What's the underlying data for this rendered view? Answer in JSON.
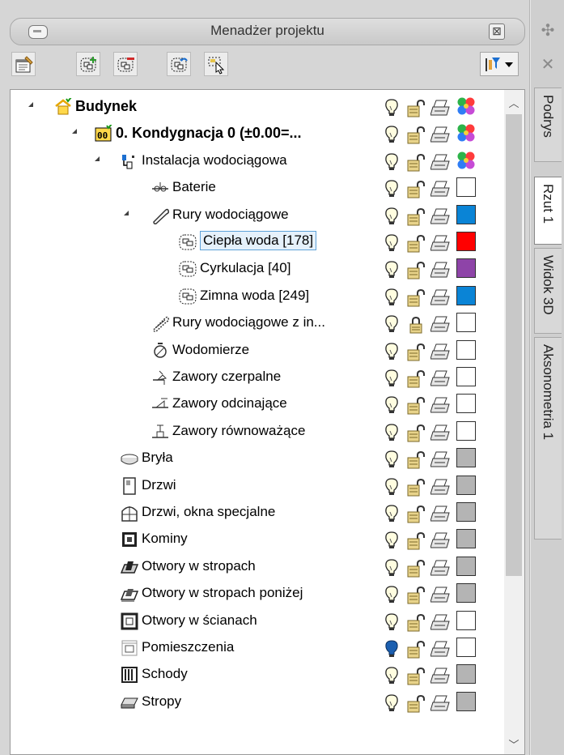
{
  "panel": {
    "title": "Menadżer projektu",
    "close_symbol": "⊠"
  },
  "toolbar": {
    "buttons": [
      "properties-icon",
      "add-layer-icon",
      "remove-layer-icon",
      "move-layer-icon",
      "select-tool-icon"
    ],
    "filter": "filter-dropdown"
  },
  "tree": {
    "rows": [
      {
        "label": "Budynek",
        "level": 0,
        "toggle": "open",
        "icon": "building-icon",
        "bold": true,
        "bulb": "on",
        "lock": "unlocked",
        "color": "multi"
      },
      {
        "label": "0. Kondygnacja 0 (±0.00=...",
        "level": 1,
        "toggle": "open",
        "icon": "storey-icon",
        "bold": true,
        "bulb": "on",
        "lock": "unlocked",
        "color": "multi"
      },
      {
        "label": "Instalacja wodociągowa",
        "level": 2,
        "toggle": "open",
        "icon": "installation-icon",
        "bulb": "on",
        "lock": "unlocked",
        "color": "multi"
      },
      {
        "label": "Baterie",
        "level": 3,
        "toggle": "none",
        "icon": "faucet-icon",
        "bulb": "on",
        "lock": "unlocked",
        "color": "#ffffff"
      },
      {
        "label": "Rury wodociągowe",
        "level": 3,
        "toggle": "open",
        "icon": "pipe-icon",
        "bulb": "on",
        "lock": "unlocked",
        "color": "#0a84d6"
      },
      {
        "label": "Ciepła woda [178]",
        "level": 4,
        "toggle": "none",
        "icon": "layer-icon",
        "selected": true,
        "bulb": "on",
        "lock": "unlocked",
        "color": "#ff0000"
      },
      {
        "label": "Cyrkulacja [40]",
        "level": 4,
        "toggle": "none",
        "icon": "layer-icon",
        "bulb": "on",
        "lock": "unlocked",
        "color": "#8e44a8"
      },
      {
        "label": "Zimna woda [249]",
        "level": 4,
        "toggle": "none",
        "icon": "layer-icon",
        "bulb": "on",
        "lock": "unlocked",
        "color": "#0a84d6"
      },
      {
        "label": "Rury wodociągowe z in...",
        "level": 3,
        "toggle": "none",
        "icon": "insulated-pipe-icon",
        "bulb": "on",
        "lock": "locked",
        "color": "#ffffff"
      },
      {
        "label": "Wodomierze",
        "level": 3,
        "toggle": "none",
        "icon": "water-meter-icon",
        "bulb": "on",
        "lock": "unlocked",
        "color": "#ffffff"
      },
      {
        "label": "Zawory czerpalne",
        "level": 3,
        "toggle": "none",
        "icon": "tap-valve-icon",
        "bulb": "on",
        "lock": "unlocked",
        "color": "#ffffff"
      },
      {
        "label": "Zawory odcinające",
        "level": 3,
        "toggle": "none",
        "icon": "shutoff-valve-icon",
        "bulb": "on",
        "lock": "unlocked",
        "color": "#ffffff"
      },
      {
        "label": "Zawory równoważące",
        "level": 3,
        "toggle": "none",
        "icon": "balancing-valve-icon",
        "bulb": "on",
        "lock": "unlocked",
        "color": "#ffffff"
      },
      {
        "label": "Bryła",
        "level": 2,
        "toggle": "none",
        "icon": "solid-icon",
        "bulb": "on",
        "lock": "unlocked",
        "color": "#b4b4b4"
      },
      {
        "label": "Drzwi",
        "level": 2,
        "toggle": "none",
        "icon": "door-icon",
        "bulb": "on",
        "lock": "unlocked",
        "color": "#b4b4b4"
      },
      {
        "label": "Drzwi, okna specjalne",
        "level": 2,
        "toggle": "none",
        "icon": "special-window-icon",
        "bulb": "on",
        "lock": "unlocked",
        "color": "#b4b4b4"
      },
      {
        "label": "Kominy",
        "level": 2,
        "toggle": "none",
        "icon": "chimney-icon",
        "bulb": "on",
        "lock": "unlocked",
        "color": "#b4b4b4"
      },
      {
        "label": "Otwory w stropach",
        "level": 2,
        "toggle": "none",
        "icon": "slab-opening-icon",
        "bulb": "on",
        "lock": "unlocked",
        "color": "#b4b4b4"
      },
      {
        "label": "Otwory w stropach poniżej",
        "level": 2,
        "toggle": "none",
        "icon": "slab-opening-below-icon",
        "bulb": "on",
        "lock": "unlocked",
        "color": "#b4b4b4"
      },
      {
        "label": "Otwory w ścianach",
        "level": 2,
        "toggle": "none",
        "icon": "wall-opening-icon",
        "bulb": "on",
        "lock": "unlocked",
        "color": "#ffffff"
      },
      {
        "label": "Pomieszczenia",
        "level": 2,
        "toggle": "closed",
        "icon": "room-icon",
        "bulb": "blue",
        "lock": "unlocked",
        "color": "#ffffff"
      },
      {
        "label": "Schody",
        "level": 2,
        "toggle": "none",
        "icon": "stairs-icon",
        "bulb": "on",
        "lock": "unlocked",
        "color": "#b4b4b4"
      },
      {
        "label": "Stropy",
        "level": 2,
        "toggle": "none",
        "icon": "slab-icon",
        "bulb": "on",
        "lock": "unlocked",
        "color": "#b4b4b4"
      }
    ]
  },
  "side_tabs": [
    {
      "label": "Podrys",
      "active": false
    },
    {
      "label": "Rzut 1",
      "active": true
    },
    {
      "label": "Widok 3D",
      "active": false
    },
    {
      "label": "Aksonometria 1",
      "active": false
    }
  ],
  "side_pins": [
    "pin-icon",
    "close-x-icon"
  ]
}
